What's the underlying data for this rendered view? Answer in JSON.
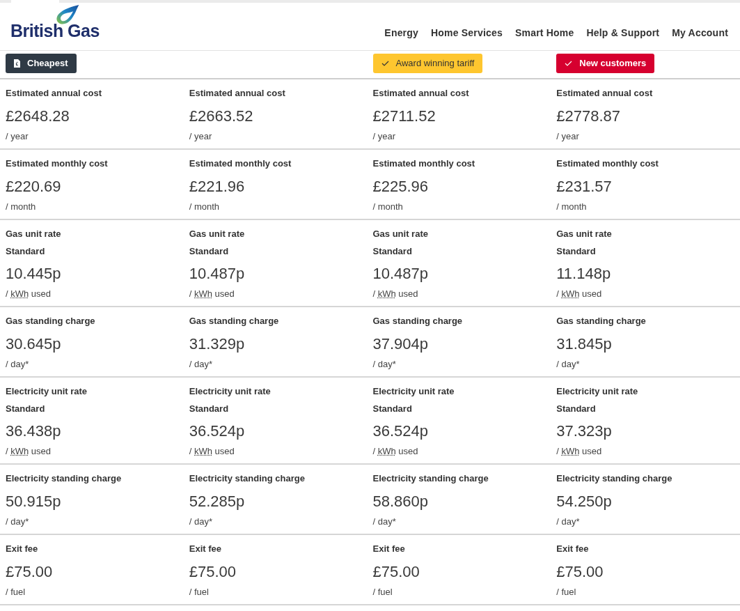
{
  "header": {
    "logo": "British Gas",
    "nav": [
      "Energy",
      "Home Services",
      "Smart Home",
      "Help & Support",
      "My Account"
    ]
  },
  "columns": [
    {
      "badge": {
        "kind": "cheapest",
        "label": "Cheapest"
      }
    },
    {},
    {
      "badge": {
        "kind": "award",
        "label": "Award winning tariff"
      }
    },
    {
      "badge": {
        "kind": "new",
        "label": "New customers"
      }
    }
  ],
  "rows": [
    {
      "cells": [
        {
          "label": "Estimated annual cost",
          "value": "£2648.28",
          "unit": "/ year"
        },
        {
          "label": "Estimated annual cost",
          "value": "£2663.52",
          "unit": "/ year"
        },
        {
          "label": "Estimated annual cost",
          "value": "£2711.52",
          "unit": "/ year"
        },
        {
          "label": "Estimated annual cost",
          "value": "£2778.87",
          "unit": "/ year"
        }
      ]
    },
    {
      "cells": [
        {
          "label": "Estimated monthly cost",
          "value": "£220.69",
          "unit": "/ month"
        },
        {
          "label": "Estimated monthly cost",
          "value": "£221.96",
          "unit": "/ month"
        },
        {
          "label": "Estimated monthly cost",
          "value": "£225.96",
          "unit": "/ month"
        },
        {
          "label": "Estimated monthly cost",
          "value": "£231.57",
          "unit": "/ month"
        }
      ]
    },
    {
      "cells": [
        {
          "label": "Gas unit rate",
          "sublabel": "Standard",
          "value": "10.445p",
          "unit": "/",
          "abbr": "kWh",
          "unit_after": "used"
        },
        {
          "label": "Gas unit rate",
          "sublabel": "Standard",
          "value": "10.487p",
          "unit": "/",
          "abbr": "kWh",
          "unit_after": "used"
        },
        {
          "label": "Gas unit rate",
          "sublabel": "Standard",
          "value": "10.487p",
          "unit": "/",
          "abbr": "kWh",
          "unit_after": "used"
        },
        {
          "label": "Gas unit rate",
          "sublabel": "Standard",
          "value": "11.148p",
          "unit": "/",
          "abbr": "kWh",
          "unit_after": "used"
        }
      ]
    },
    {
      "cells": [
        {
          "label": "Gas standing charge",
          "value": "30.645p",
          "unit": "/ day*"
        },
        {
          "label": "Gas standing charge",
          "value": "31.329p",
          "unit": "/ day*"
        },
        {
          "label": "Gas standing charge",
          "value": "37.904p",
          "unit": "/ day*"
        },
        {
          "label": "Gas standing charge",
          "value": "31.845p",
          "unit": "/ day*"
        }
      ]
    },
    {
      "cells": [
        {
          "label": "Electricity unit rate",
          "sublabel": "Standard",
          "value": "36.438p",
          "unit": "/",
          "abbr": "kWh",
          "unit_after": "used"
        },
        {
          "label": "Electricity unit rate",
          "sublabel": "Standard",
          "value": "36.524p",
          "unit": "/",
          "abbr": "kWh",
          "unit_after": "used"
        },
        {
          "label": "Electricity unit rate",
          "sublabel": "Standard",
          "value": "36.524p",
          "unit": "/",
          "abbr": "kWh",
          "unit_after": "used"
        },
        {
          "label": "Electricity unit rate",
          "sublabel": "Standard",
          "value": "37.323p",
          "unit": "/",
          "abbr": "kWh",
          "unit_after": "used"
        }
      ]
    },
    {
      "cells": [
        {
          "label": "Electricity standing charge",
          "value": "50.915p",
          "unit": "/ day*"
        },
        {
          "label": "Electricity standing charge",
          "value": "52.285p",
          "unit": "/ day*"
        },
        {
          "label": "Electricity standing charge",
          "value": "58.860p",
          "unit": "/ day*"
        },
        {
          "label": "Electricity standing charge",
          "value": "54.250p",
          "unit": "/ day*"
        }
      ]
    },
    {
      "cells": [
        {
          "label": "Exit fee",
          "value": "£75.00",
          "unit": "/ fuel"
        },
        {
          "label": "Exit fee",
          "value": "£75.00",
          "unit": "/ fuel"
        },
        {
          "label": "Exit fee",
          "value": "£75.00",
          "unit": "/ fuel"
        },
        {
          "label": "Exit fee",
          "value": "£75.00",
          "unit": "/ fuel"
        }
      ]
    }
  ]
}
